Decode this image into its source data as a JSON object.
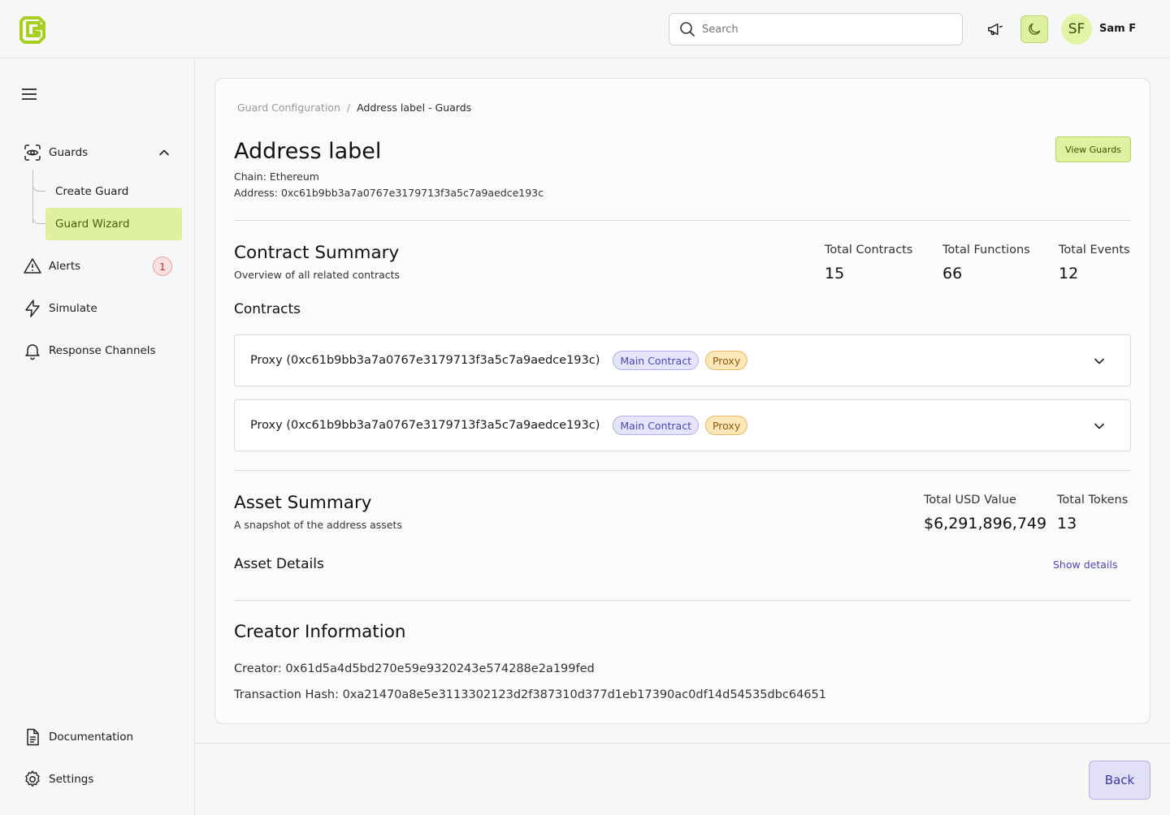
{
  "header": {
    "search_placeholder": "Search",
    "avatar_initials": "SF",
    "user_name": "Sam F"
  },
  "sidebar": {
    "guards_label": "Guards",
    "sub_items": [
      {
        "label": "Create Guard"
      },
      {
        "label": "Guard Wizard"
      }
    ],
    "alerts_label": "Alerts",
    "alerts_count": "1",
    "simulate_label": "Simulate",
    "response_channels_label": "Response Channels",
    "documentation_label": "Documentation",
    "settings_label": "Settings"
  },
  "breadcrumb": {
    "parent": "Guard Configuration",
    "separator": "/",
    "current": "Address label - Guards"
  },
  "page": {
    "title": "Address label",
    "view_guards_label": "View Guards",
    "chain": "Chain: Ethereum",
    "address": "Address: 0xc61b9bb3a7a0767e3179713f3a5c7a9aedce193c"
  },
  "contract_summary": {
    "title": "Contract Summary",
    "subtitle": "Overview of all related contracts",
    "stats": [
      {
        "label": "Total Contracts",
        "value": "15"
      },
      {
        "label": "Total Functions",
        "value": "66"
      },
      {
        "label": "Total Events",
        "value": "12"
      }
    ],
    "contracts_heading": "Contracts",
    "contracts": [
      {
        "name": "Proxy (0xc61b9bb3a7a0767e3179713f3a5c7a9aedce193c)",
        "tag_main": "Main Contract",
        "tag_proxy": "Proxy"
      },
      {
        "name": "Proxy (0xc61b9bb3a7a0767e3179713f3a5c7a9aedce193c)",
        "tag_main": "Main Contract",
        "tag_proxy": "Proxy"
      }
    ]
  },
  "asset_summary": {
    "title": "Asset Summary",
    "subtitle": "A snapshot of the address assets",
    "stats": [
      {
        "label": "Total USD Value",
        "value": "$6,291,896,749"
      },
      {
        "label": "Total Tokens",
        "value": "13"
      }
    ],
    "details_heading": "Asset Details",
    "show_details_label": "Show details"
  },
  "creator": {
    "title": "Creator Information",
    "creator": "Creator: 0x61d5a4d5bd270e59e9320243e574288e2a199fed",
    "tx_hash": "Transaction Hash: 0xa21470a8e5e3113302123d2f387310d377d1eb17390ac0df14d54535dbc64651"
  },
  "footer": {
    "back_label": "Back"
  },
  "colors": {
    "accent": "#dff0a0",
    "accent_border": "#b9d36a",
    "logo": "#a6cf1f",
    "link": "#4b47b8",
    "alert": "#c03030"
  }
}
